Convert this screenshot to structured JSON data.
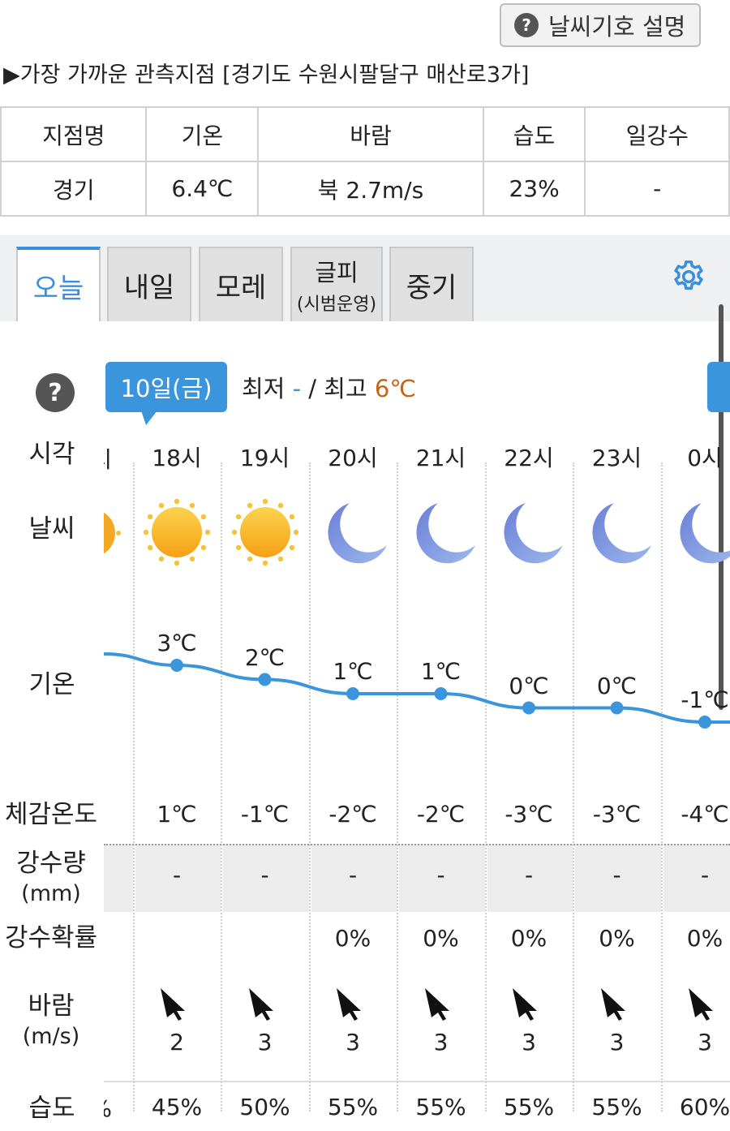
{
  "header": {
    "legend_button": "날씨기호 설명",
    "station": "▶가장 가까운 관측지점 [경기도 수원시팔달구 매산로3가]"
  },
  "observation": {
    "headers": [
      "지점명",
      "기온",
      "바람",
      "습도",
      "일강수"
    ],
    "values": [
      "경기",
      "6.4℃",
      "북 2.7m/s",
      "23%",
      "-"
    ]
  },
  "tabs": [
    {
      "label": "오늘",
      "active": true
    },
    {
      "label": "내일"
    },
    {
      "label": "모레"
    },
    {
      "label": "글피",
      "sub": "(시범운영)"
    },
    {
      "label": "중기"
    }
  ],
  "forecast": {
    "date_label": "10일(금)",
    "min_label": "최저",
    "min_value": "-",
    "separator": "/",
    "max_label": "최고",
    "max_value": "6℃",
    "row_labels": {
      "time": "시각",
      "weather": "날씨",
      "temp": "기온",
      "feels": "체감온도",
      "precip": "강수량",
      "precip_unit": "(mm)",
      "pop": "강수확률",
      "wind": "바람",
      "wind_unit": "(m/s)",
      "humidity": "습도"
    },
    "hours": [
      {
        "time": "18시",
        "icon": "sun-icon",
        "temp": "3℃",
        "temp_value": 3,
        "feels": "1℃",
        "precip": "-",
        "pop": "",
        "wind": "2",
        "humidity": "45%"
      },
      {
        "time": "19시",
        "icon": "sun-icon",
        "temp": "2℃",
        "temp_value": 2,
        "feels": "-1℃",
        "precip": "-",
        "pop": "",
        "wind": "3",
        "humidity": "50%"
      },
      {
        "time": "20시",
        "icon": "moon-icon",
        "temp": "1℃",
        "temp_value": 1,
        "feels": "-2℃",
        "precip": "-",
        "pop": "0%",
        "wind": "3",
        "humidity": "55%"
      },
      {
        "time": "21시",
        "icon": "moon-icon",
        "temp": "1℃",
        "temp_value": 1,
        "feels": "-2℃",
        "precip": "-",
        "pop": "0%",
        "wind": "3",
        "humidity": "55%"
      },
      {
        "time": "22시",
        "icon": "moon-icon",
        "temp": "0℃",
        "temp_value": 0,
        "feels": "-3℃",
        "precip": "-",
        "pop": "0%",
        "wind": "3",
        "humidity": "55%"
      },
      {
        "time": "23시",
        "icon": "moon-icon",
        "temp": "0℃",
        "temp_value": 0,
        "feels": "-3℃",
        "precip": "-",
        "pop": "0%",
        "wind": "3",
        "humidity": "55%"
      },
      {
        "time": "0시",
        "icon": "moon-icon",
        "temp": "-1℃",
        "temp_value": -1,
        "feels": "-4℃",
        "precip": "-",
        "pop": "0%",
        "wind": "3",
        "humidity": "60%"
      }
    ],
    "colors": {
      "accent": "#3a95dc",
      "max": "#c86418"
    }
  }
}
